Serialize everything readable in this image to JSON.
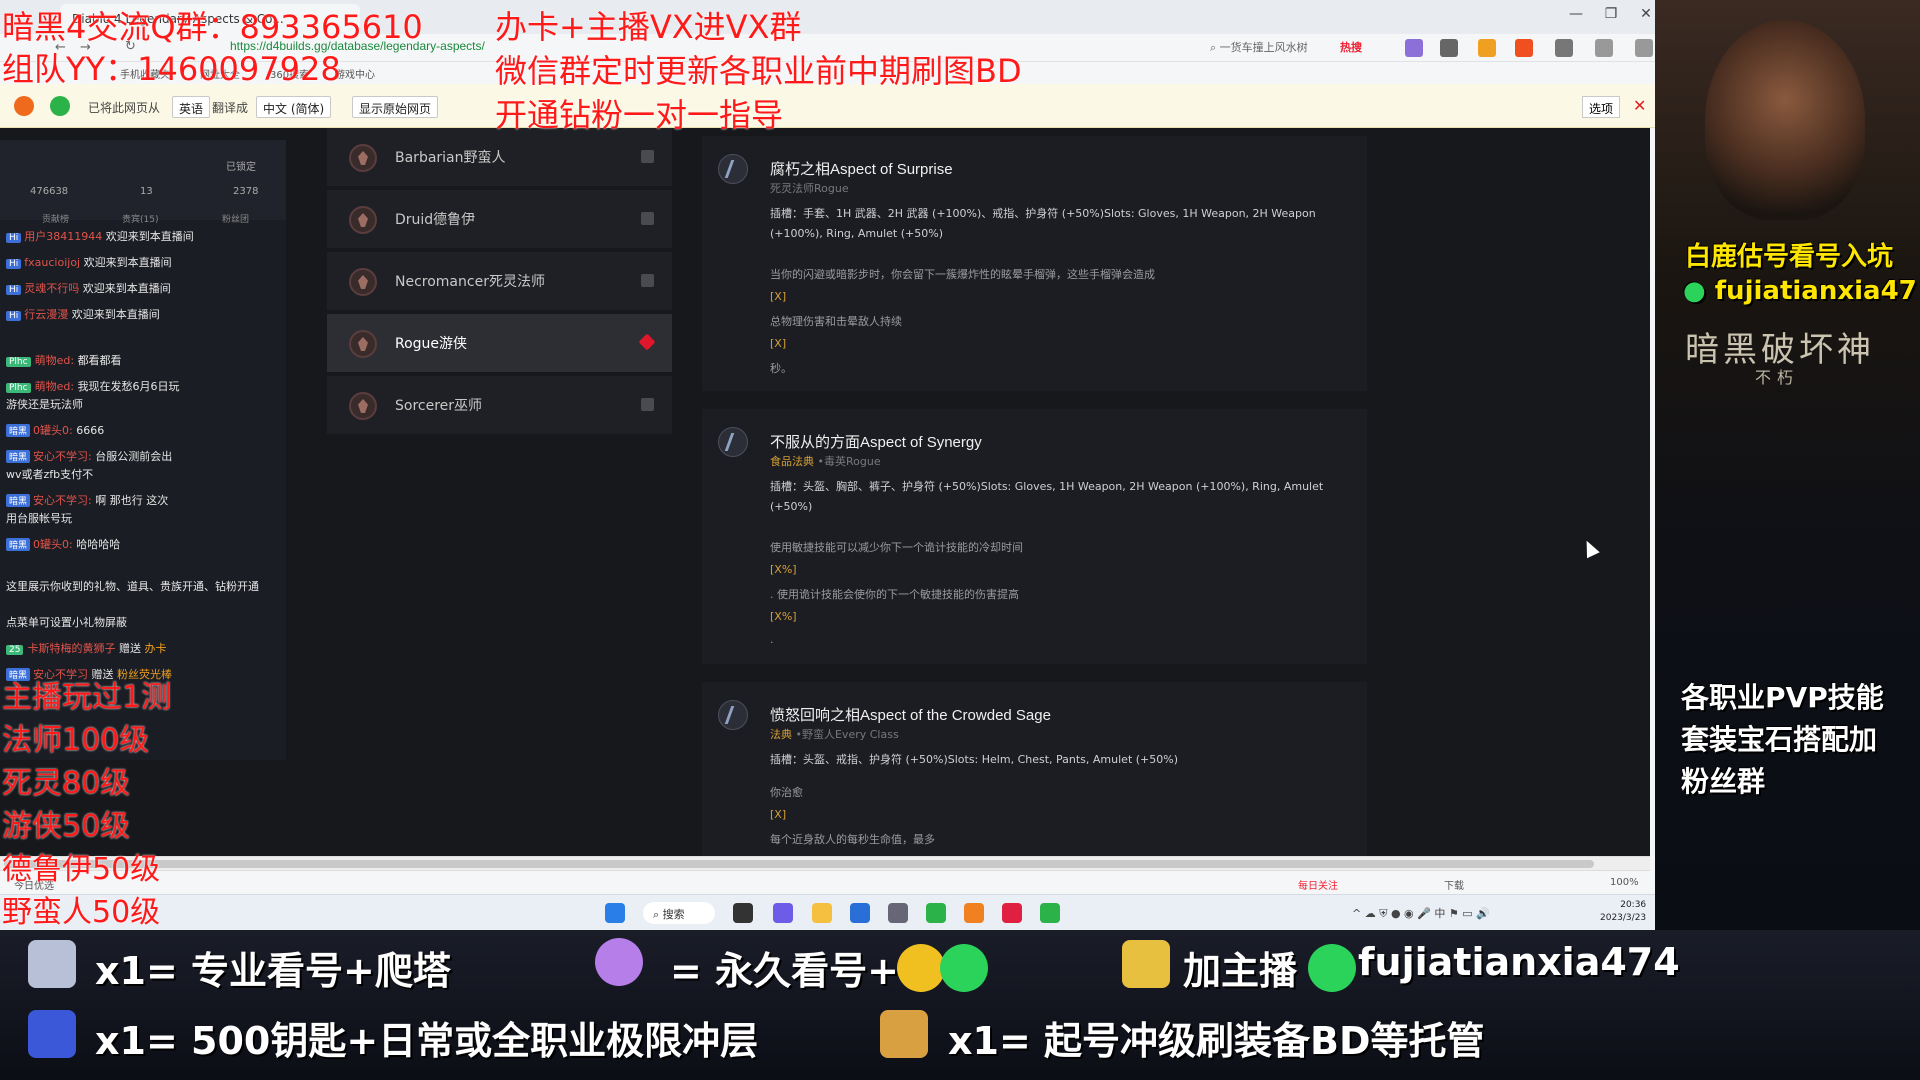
{
  "browser": {
    "tab_title": "Diablo 4 Legendary Aspects & Co...",
    "url": "https://d4builds.gg/database/legendary-aspects/",
    "search_text": "一货车撞上风水树",
    "hot_label": "热搜",
    "bookmarks": [
      "手机收藏夹",
      "网址大全",
      "360搜索",
      "游戏中心"
    ],
    "translate": {
      "from_label": "已将此网页从",
      "source_lang": "英语",
      "to_label": "翻译成",
      "target_lang": "中文 (简体)",
      "show_original": "显示原始网页",
      "options": "选项",
      "close": "✕"
    },
    "status": {
      "left": "今日优选",
      "daily_follow": "每日关注",
      "download": "下载",
      "zoom": "100%"
    },
    "taskbar": {
      "search": "搜索",
      "time": "20:36",
      "date": "2023/3/23",
      "lang": "中"
    }
  },
  "classes": [
    {
      "label": "Barbarian野蛮人",
      "active": false
    },
    {
      "label": "Druid德鲁伊",
      "active": false
    },
    {
      "label": "Necromancer死灵法师",
      "active": false
    },
    {
      "label": "Rogue游侠",
      "active": true
    },
    {
      "label": "Sorcerer巫师",
      "active": false
    }
  ],
  "aspects": [
    {
      "title": "腐朽之相Aspect of Surprise",
      "subtitle": "死灵法师Rogue",
      "slots": "插槽：手套、1H 武器、2H 武器 (+100%)、戒指、护身符 (+50%)Slots: Gloves, 1H Weapon, 2H Weapon (+100%), Ring, Amulet (+50%)",
      "lines": [
        "当你的闪避或暗影步时，你会留下一簇爆炸性的眩晕手榴弹，这些手榴弹会造成",
        "[X]",
        "总物理伤害和击晕敌人持续",
        "[X]",
        "秒。"
      ]
    },
    {
      "title": "不服从的方面Aspect of Synergy",
      "subtitle_hl": "食品法典",
      "subtitle": " •毒英Rogue",
      "slots": "插槽：头盔、胸部、裤子、护身符 (+50%)Slots: Gloves, 1H Weapon, 2H Weapon (+100%), Ring, Amulet (+50%)",
      "lines": [
        "使用敏捷技能可以减少你下一个诡计技能的冷却时间",
        "[X%]",
        ". 使用诡计技能会使你的下一个敏捷技能的伤害提高",
        "[X%]",
        "."
      ]
    },
    {
      "title": "愤怒回响之相Aspect of the Crowded Sage",
      "subtitle_hl": "法典",
      "subtitle": " •野蛮人Every Class",
      "slots": "插槽：头盔、戒指、护身符 (+50%)Slots: Helm, Chest, Pants, Amulet (+50%)",
      "lines": [
        "你治愈",
        "[X]",
        "每个近身敌人的每秒生命值，最多"
      ]
    }
  ],
  "chat": {
    "locked": "已锁定",
    "count1": "476638",
    "count2": "13",
    "count3": "2378",
    "tabs": [
      "贡献榜",
      "贵宾(15)",
      "粉丝团"
    ],
    "messages": [
      {
        "user": "用户38411944",
        "text": "欢迎来到本直播间"
      },
      {
        "user": "fxaucioijoj",
        "text": "欢迎来到本直播间"
      },
      {
        "user": "灵魂不行吗",
        "text": "欢迎来到本直播间"
      },
      {
        "user": "行云漫漫",
        "text": "欢迎来到本直播间"
      },
      {
        "user": "萌物ed:",
        "text": "都看都看"
      },
      {
        "user": "萌物ed:",
        "text": "我现在发愁6月6日玩"
      },
      {
        "user": "",
        "text": "游侠还是玩法师"
      },
      {
        "user": "0罐头0:",
        "text": "6666"
      },
      {
        "user": "安心不学习:",
        "text": "台服公测前会出"
      },
      {
        "user": "",
        "text": "wv或者zfb支付不"
      },
      {
        "user": "安心不学习:",
        "text": "啊 那也行 这次"
      },
      {
        "user": "",
        "text": "用台服帐号玩"
      },
      {
        "user": "0罐头0:",
        "text": "哈哈哈哈"
      }
    ],
    "notice1": "这里展示你收到的礼物、道具、贵族开通、钻粉开通",
    "notice2": "点菜单可设置小礼物屏蔽",
    "gift1_user": "卡斯特梅的黄狮子",
    "gift1_text": "赠送",
    "gift1_item": "办卡",
    "gift2_user": "安心不学习",
    "gift2_text": "赠送",
    "gift2_item": "粉丝荧光棒"
  },
  "overlay": {
    "top1": "暗黑4交流Q群：893365610",
    "top2": "组队YY：1460097928",
    "mid1": "办卡+主播VX进VX群",
    "mid2": "微信群定时更新各职业前中期刷图BD",
    "mid3": "开通钻粉一对一指导",
    "left_lines": [
      "主播玩过1测",
      "法师100级",
      "死灵80级",
      "游侠50级",
      "德鲁伊50级",
      "野蛮人50级"
    ],
    "right1": "白鹿估号看号入坑",
    "right2": "fujiatianxia47",
    "right3": "暗黑破坏神",
    "right4": "不朽",
    "right5": "各职业PVP技能",
    "right6": "套装宝石搭配加",
    "right7": "粉丝群",
    "banner": [
      "x1= 专业看号+爬塔",
      "= 永久看号+",
      "加主播",
      "fujiatianxia474",
      "x1= 500钥匙+日常或全职业极限冲层",
      "x1= 起号冲级刷装备BD等托管"
    ]
  },
  "colors": {
    "accent_red": "#e0162b",
    "gold": "#d6a036",
    "overlay_red": "#ff1a1a",
    "promo_yellow": "#ffe600"
  }
}
